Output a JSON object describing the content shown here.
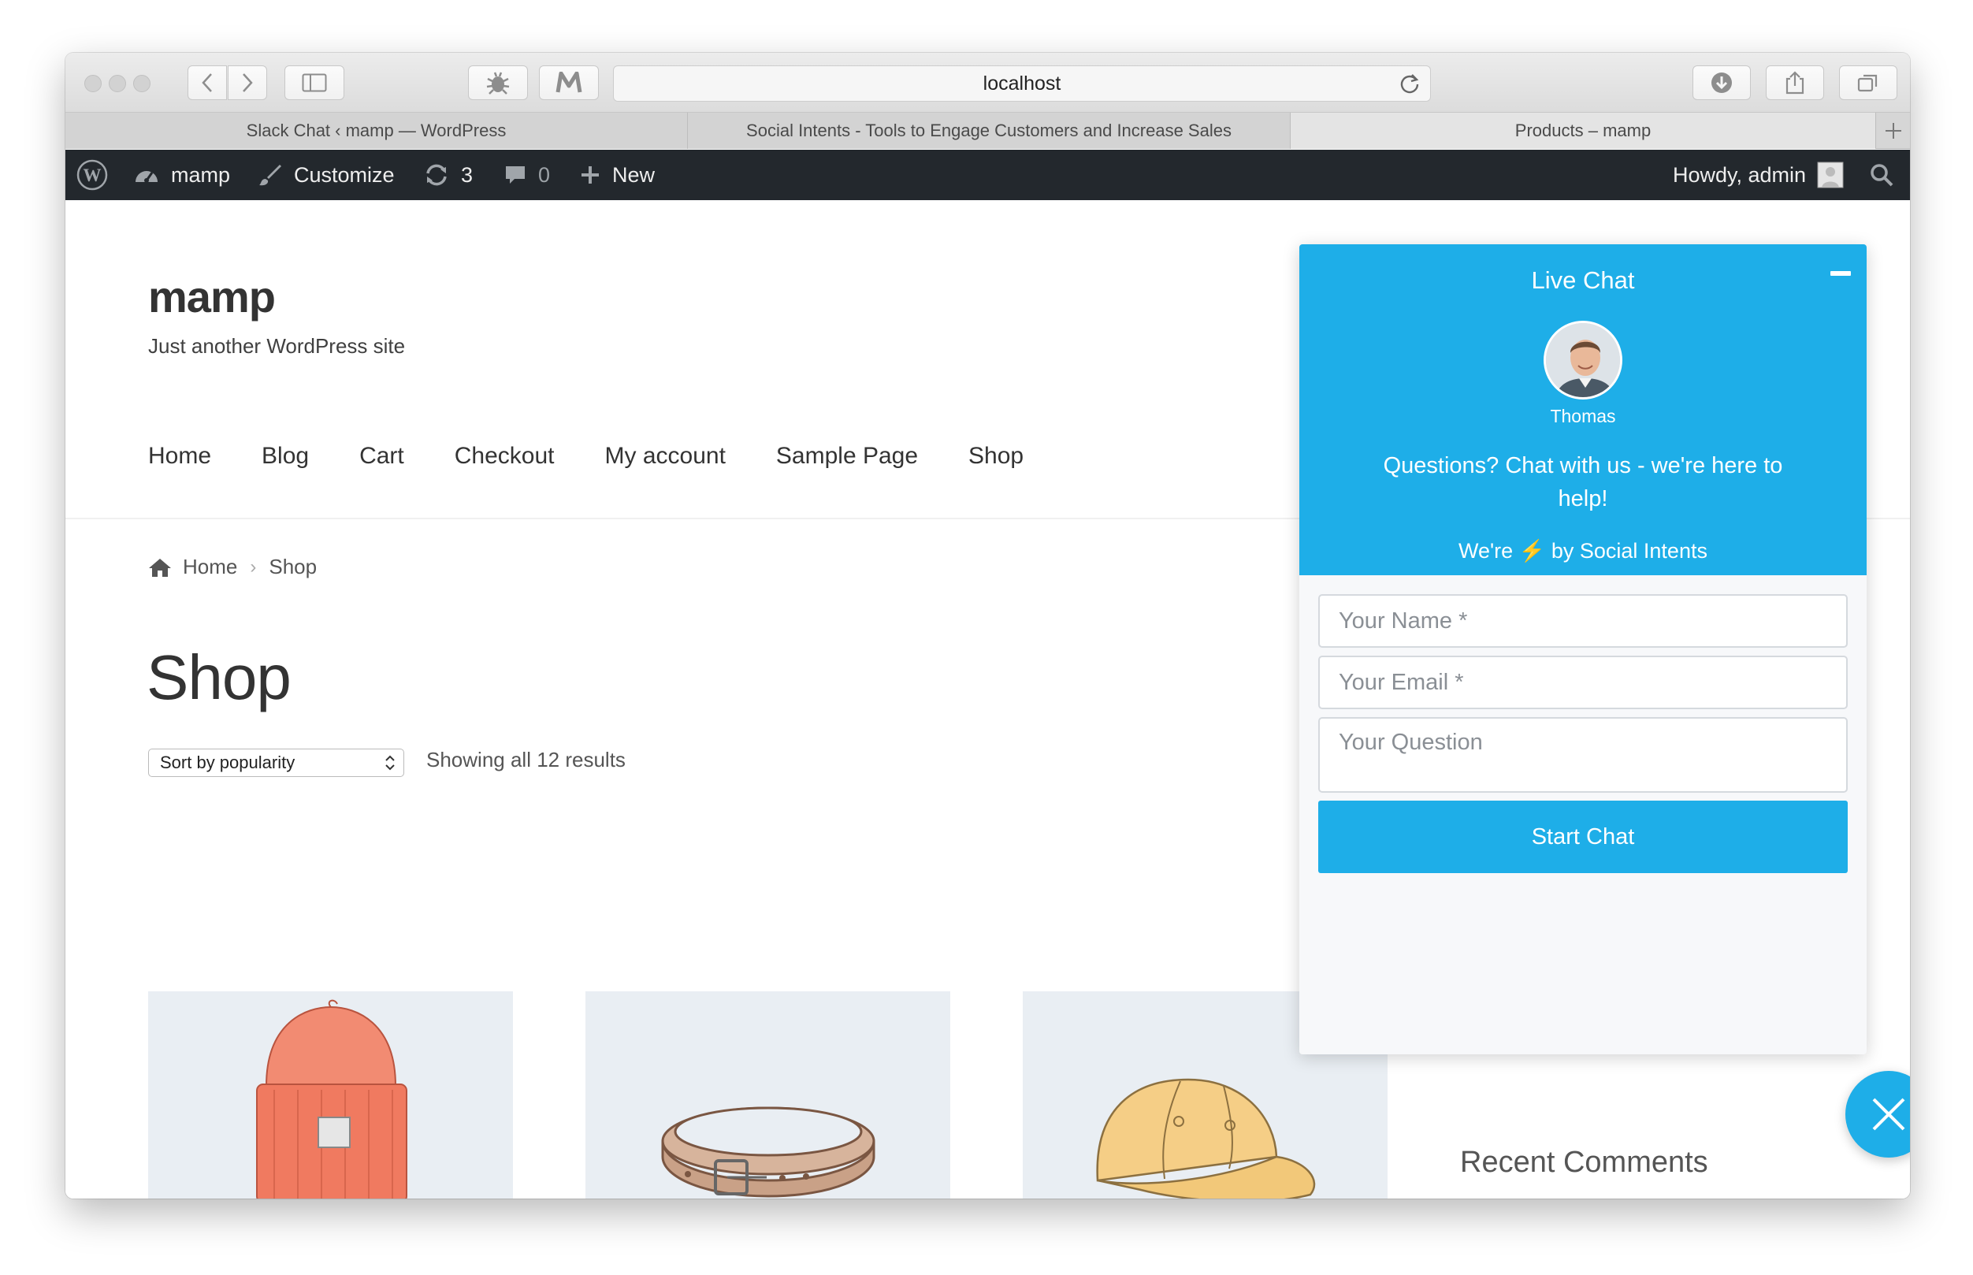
{
  "browser": {
    "url": "localhost",
    "tabs": [
      {
        "title": "Slack Chat ‹ mamp — WordPress"
      },
      {
        "title": "Social Intents - Tools to Engage Customers and Increase Sales"
      },
      {
        "title": "Products – mamp"
      }
    ]
  },
  "adminbar": {
    "site_name": "mamp",
    "customize": "Customize",
    "updates_count": "3",
    "comments_count": "0",
    "new": "New",
    "howdy": "Howdy, admin"
  },
  "site": {
    "title": "mamp",
    "description": "Just another WordPress site",
    "nav": [
      "Home",
      "Blog",
      "Cart",
      "Checkout",
      "My account",
      "Sample Page",
      "Shop"
    ]
  },
  "breadcrumb": {
    "home": "Home",
    "current": "Shop"
  },
  "shop": {
    "title": "Shop",
    "sort_value": "Sort by popularity",
    "results_text": "Showing all 12 results",
    "products": [
      {
        "name": "beanie",
        "icon": "beanie-image"
      },
      {
        "name": "belt",
        "icon": "belt-image"
      },
      {
        "name": "cap",
        "icon": "cap-image"
      }
    ]
  },
  "sidebar": {
    "recent_comments": "Recent Comments"
  },
  "chat": {
    "title": "Live Chat",
    "agent_name": "Thomas",
    "message": "Questions? Chat with us - we're here to help!",
    "powered_prefix": "We're",
    "powered_bolt": "⚡",
    "powered_suffix": "by Social Intents",
    "name_placeholder": "Your Name *",
    "email_placeholder": "Your Email *",
    "question_placeholder": "Your Question",
    "start_button": "Start Chat",
    "accent_color": "#1eaee8"
  }
}
